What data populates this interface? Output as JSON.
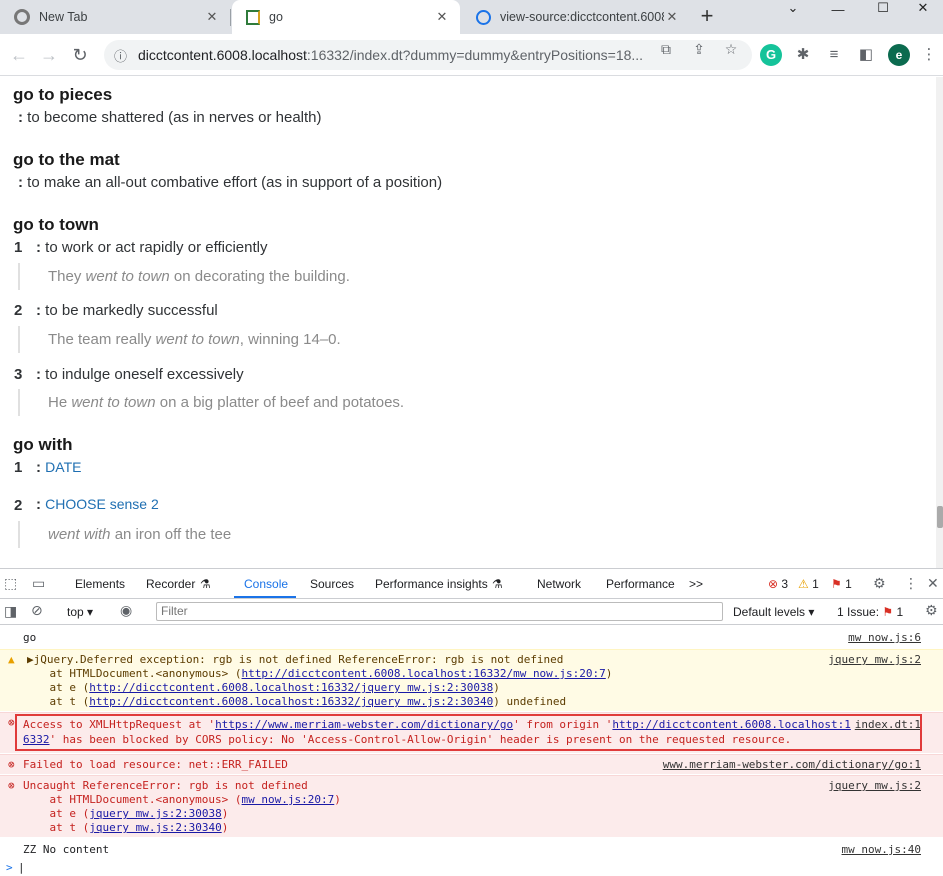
{
  "browser": {
    "tabs": [
      {
        "title": "New Tab",
        "icon": "chrome-icon"
      },
      {
        "title": "go",
        "icon": "book-icon",
        "active": true
      },
      {
        "title": "view-source:dicctcontent.6008",
        "icon": "globe-icon"
      }
    ],
    "new_tab_glyph": "+",
    "address": {
      "host": "dicctcontent.6008.localhost",
      "rest": ":16332/index.dt?dummy=dummy&entryPositions=18..."
    },
    "avatar_letter": "e",
    "grammarly_letter": "G"
  },
  "page": {
    "entries": [
      {
        "head": "go to pieces",
        "def": "to become shattered (as in nerves or health)"
      },
      {
        "head": "go to the mat",
        "def": "to make an all-out combative effort (as in support of a position)"
      },
      {
        "head": "go to town",
        "senses": [
          {
            "num": "1",
            "def": "to work or act rapidly or efficiently",
            "ex_pre": "They ",
            "ex_it": "went to town",
            "ex_post": " on decorating the building."
          },
          {
            "num": "2",
            "def": "to be markedly successful",
            "ex_pre": "The team really ",
            "ex_it": "went to town",
            "ex_post": ", winning 14–0."
          },
          {
            "num": "3",
            "def": "to indulge oneself excessively",
            "ex_pre": "He ",
            "ex_it": "went to town",
            "ex_post": " on a big platter of beef and potatoes."
          }
        ]
      },
      {
        "head": "go with",
        "senses": [
          {
            "num": "1",
            "link": "DATE"
          },
          {
            "num": "2",
            "link": "CHOOSE sense 2",
            "ex_it": "went with",
            "ex_post": " an iron off the tee"
          }
        ]
      }
    ],
    "colon": ":"
  },
  "devtools": {
    "tabs": [
      "Elements",
      "Recorder",
      "Console",
      "Sources",
      "Performance insights",
      "Network",
      "Performance"
    ],
    "more": ">>",
    "errors_count": "3",
    "warnings_count": "1",
    "issues_count": "1",
    "context": "top",
    "filter_placeholder": "Filter",
    "levels": "Default levels",
    "issues_label": "1 Issue:",
    "issues_num": "1",
    "logs": {
      "l1": {
        "text": "go",
        "src": "mw now.js:6"
      },
      "l2": {
        "line1": "▶jQuery.Deferred exception: rgb is not defined ReferenceError: rgb is not defined",
        "src": "jquery mw.js:2",
        "line2a": "    at HTMLDocument.<anonymous> (",
        "line2u": "http://dicctcontent.6008.localhost:16332/mw now.js:20:7",
        "line2b": ")",
        "line3a": "    at e (",
        "line3u": "http://dicctcontent.6008.localhost:16332/jquery mw.js:2:30038",
        "line3b": ")",
        "line4a": "    at t (",
        "line4u": "http://dicctcontent.6008.localhost:16332/jquery mw.js:2:30340",
        "line4b": ") undefined"
      },
      "l3": {
        "a": "Access to XMLHttpRequest at '",
        "u1": "https://www.merriam-webster.com/dictionary/go",
        "b": "' from origin '",
        "u2": "http://dicctcontent.6008.localhost:1",
        "src": "index.dt:1",
        "c_u": "6332",
        "c": "' has been blocked by CORS policy: No 'Access-Control-Allow-Origin' header is present on the requested resource."
      },
      "l4": {
        "text": "Failed to load resource: net::ERR_FAILED",
        "src": "www.merriam-webster.com/dictionary/go:1"
      },
      "l5": {
        "text": "Uncaught ReferenceError: rgb is not defined",
        "src": "jquery mw.js:2",
        "line2a": "    at HTMLDocument.<anonymous> (",
        "line2u": "mw now.js:20:7",
        "line2b": ")",
        "line3a": "    at e (",
        "line3u": "jquery mw.js:2:30038",
        "line3b": ")",
        "line4a": "    at t (",
        "line4u": "jquery mw.js:2:30340",
        "line4b": ")"
      },
      "l6": {
        "text": "ZZ No content",
        "src": "mw now.js:40"
      }
    },
    "prompt": ">"
  }
}
